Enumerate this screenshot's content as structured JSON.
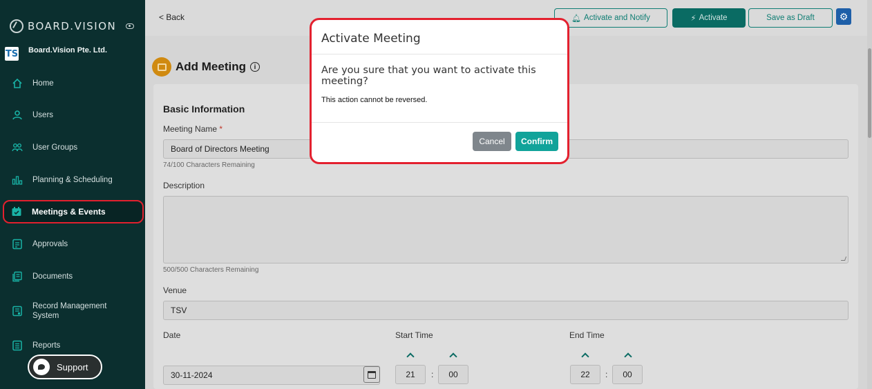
{
  "sidebar": {
    "brand": "BOARD.VISION",
    "org_name": "Board.Vision Pte. Ltd.",
    "org_logo_text": "TS",
    "items": [
      {
        "label": "Home",
        "icon": "home-icon"
      },
      {
        "label": "Users",
        "icon": "user-icon"
      },
      {
        "label": "User Groups",
        "icon": "users-icon"
      },
      {
        "label": "Planning & Scheduling",
        "icon": "bar-chart-icon"
      },
      {
        "label": "Meetings & Events",
        "icon": "calendar-check-icon"
      },
      {
        "label": "Approvals",
        "icon": "approvals-icon"
      },
      {
        "label": "Documents",
        "icon": "documents-icon"
      },
      {
        "label": "Record Management System",
        "icon": "record-icon"
      },
      {
        "label": "Reports",
        "icon": "reports-icon"
      }
    ],
    "support_label": "Support"
  },
  "topbar": {
    "back_label": "< Back",
    "activate_notify_label": "Activate and Notify",
    "activate_label": "Activate",
    "save_draft_label": "Save as Draft"
  },
  "page": {
    "title": "Add Meeting",
    "section_title": "Basic Information",
    "meeting_name_label": "Meeting Name",
    "meeting_name_value": "Board of Directors Meeting",
    "meeting_name_hint": "74/100 Characters Remaining",
    "description_label": "Description",
    "description_hint": "500/500 Characters Remaining",
    "venue_label": "Venue",
    "venue_value": "TSV",
    "date_label": "Date",
    "date_value": "30-11-2024",
    "start_time_label": "Start Time",
    "start_hour": "21",
    "start_minute": "00",
    "end_time_label": "End Time",
    "end_hour": "22",
    "end_minute": "00"
  },
  "modal": {
    "title": "Activate Meeting",
    "question": "Are you sure that you want to activate this meeting?",
    "note": "This action cannot be reversed.",
    "cancel_label": "Cancel",
    "confirm_label": "Confirm"
  },
  "colors": {
    "sidebar_bg": "#0b2f2f",
    "accent_teal": "#11a39a",
    "highlight_red": "#e3202e"
  }
}
